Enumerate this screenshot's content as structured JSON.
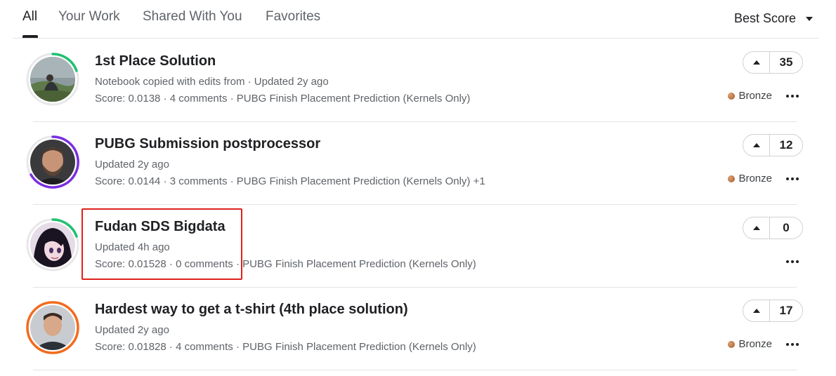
{
  "tabs": [
    {
      "label": "All",
      "active": true
    },
    {
      "label": "Your Work",
      "active": false
    },
    {
      "label": "Shared With You",
      "active": false
    },
    {
      "label": "Favorites",
      "active": false
    }
  ],
  "sort": {
    "label": "Best Score"
  },
  "colors": {
    "ring_green": "#20beff",
    "accent_red": "#e0201a",
    "bronze": "#b06a3a"
  },
  "items": [
    {
      "title": "1st Place Solution",
      "subtitle": "Notebook copied with edits from · Updated 2y ago",
      "score": "Score: 0.0138",
      "sep1": " · ",
      "comments": "4 comments",
      "sep2": " · ",
      "competition": "PUBG Finish Placement Prediction (Kernels Only)",
      "votes": "35",
      "medal": "Bronze",
      "avatar_ring": "green-partial"
    },
    {
      "title": "PUBG Submission postprocessor",
      "subtitle": "Updated 2y ago",
      "score": "Score: 0.0144",
      "sep1": " · ",
      "comments": "3 comments",
      "sep2": " · ",
      "competition": "PUBG Finish Placement Prediction (Kernels Only) +1",
      "votes": "12",
      "medal": "Bronze",
      "avatar_ring": "purple"
    },
    {
      "title": "Fudan SDS Bigdata",
      "subtitle": "Updated 4h ago",
      "score": "Score: 0.01528",
      "sep1": " · ",
      "comments": "0 comments",
      "sep2": " · ",
      "competition": "PUBG Finish Placement Prediction (Kernels Only)",
      "votes": "0",
      "medal": "",
      "avatar_ring": "green-partial"
    },
    {
      "title": "Hardest way to get a t-shirt (4th place solution)",
      "subtitle": "Updated 2y ago",
      "score": "Score: 0.01828",
      "sep1": " · ",
      "comments": "4 comments",
      "sep2": " · ",
      "competition": "PUBG Finish Placement Prediction (Kernels Only)",
      "votes": "17",
      "medal": "Bronze",
      "avatar_ring": "orange"
    }
  ]
}
